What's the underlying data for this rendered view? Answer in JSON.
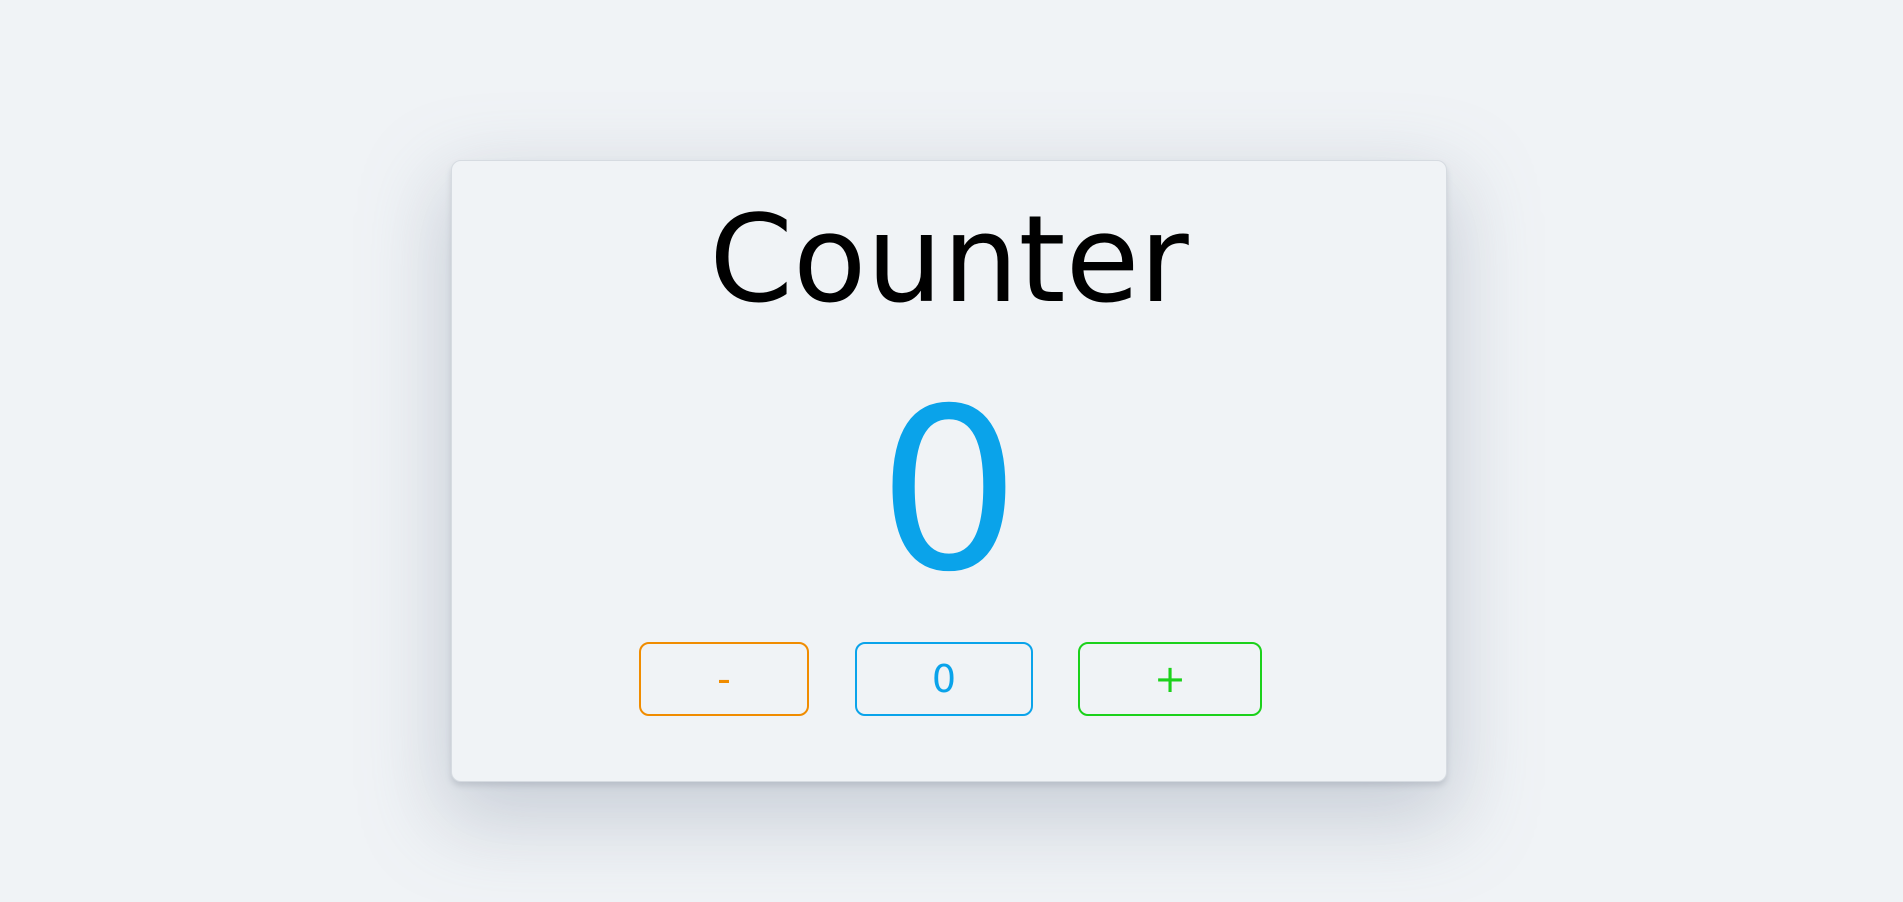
{
  "counter": {
    "title": "Counter",
    "value": "0"
  },
  "buttons": {
    "decrement_label": "-",
    "reset_label": "0",
    "increment_label": "+"
  },
  "colors": {
    "background": "#f0f3f6",
    "count": "#0aa3ea",
    "decrement": "#f08c00",
    "reset": "#0aa3ea",
    "increment": "#1bd11b"
  }
}
